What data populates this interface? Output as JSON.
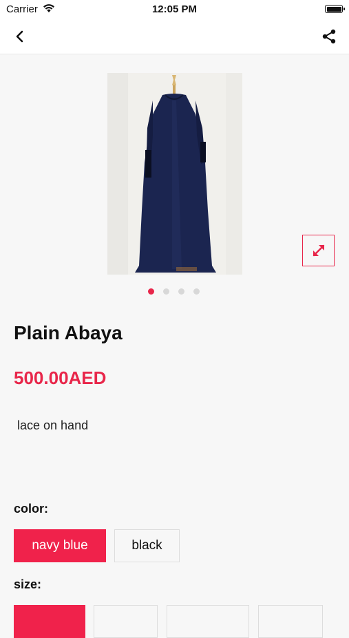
{
  "status": {
    "carrier": "Carrier",
    "time": "12:05 PM"
  },
  "icons": {
    "back": "chevron-left-icon",
    "share": "share-icon",
    "expand": "expand-arrows-icon",
    "wifi": "wifi-icon",
    "battery": "battery-icon"
  },
  "colors": {
    "accent": "#e8264a",
    "selected_bg": "#f0224b"
  },
  "product": {
    "name": "Plain Abaya",
    "price": "500.00AED",
    "description": "lace on hand",
    "image_count": 4,
    "active_image_index": 0
  },
  "options": {
    "color_label": "color:",
    "colors": [
      {
        "label": "navy blue",
        "selected": true
      },
      {
        "label": "black",
        "selected": false
      }
    ],
    "size_label": "size:"
  }
}
